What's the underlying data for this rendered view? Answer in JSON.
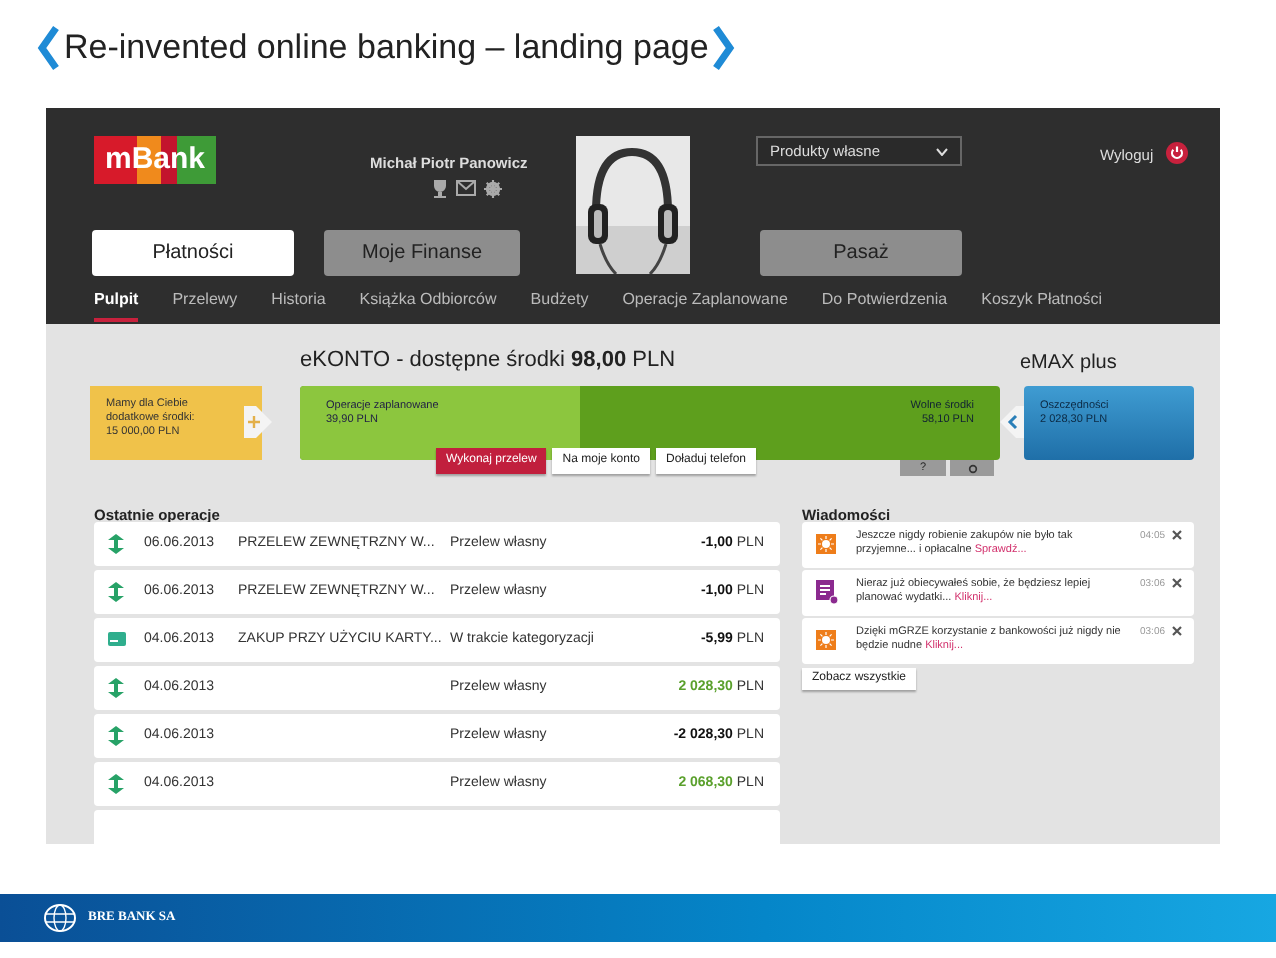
{
  "slide_title": "Re-invented online banking – landing page",
  "header": {
    "logo": "mBank",
    "user_name": "Michał Piotr Panowicz",
    "product_select": "Produkty własne",
    "logout": "Wyloguj"
  },
  "main_tabs": [
    {
      "label": "Płatności",
      "selected": true
    },
    {
      "label": "Moje Finanse",
      "selected": false
    },
    {
      "label": "Pasaż",
      "selected": false
    }
  ],
  "nav": [
    {
      "label": "Pulpit",
      "selected": true
    },
    {
      "label": "Przelewy",
      "selected": false
    },
    {
      "label": "Historia",
      "selected": false
    },
    {
      "label": "Książka Odbiorców",
      "selected": false
    },
    {
      "label": "Budżety",
      "selected": false
    },
    {
      "label": "Operacje Zaplanowane",
      "selected": false
    },
    {
      "label": "Do Potwierdzenia",
      "selected": false
    },
    {
      "label": "Koszyk Płatności",
      "selected": false
    }
  ],
  "account": {
    "title": "eKONTO - dostępne środki **98,00** PLN",
    "offer": [
      "Mamy dla Ciebie",
      "dodatkowe środki:",
      "15 000,00 PLN"
    ],
    "scheduled_label": "Operacje zaplanowane",
    "scheduled_amount": "39,90 PLN",
    "level": 0.4,
    "free_label": "Wolne środki",
    "free_amount": "58,10 PLN",
    "actions": [
      "Wykonaj przelew",
      "Na moje konto",
      "Doładuj telefon"
    ],
    "help": "?"
  },
  "savings": {
    "title": "eMAX plus",
    "label": "Oszczędności",
    "amount": "2 028,30 PLN"
  },
  "operations": {
    "title": "Ostatnie operacje",
    "rows": [
      {
        "kind": "transfer",
        "date": "06.06.2013",
        "description": "PRZELEW ZEWNĘTRZNY W...",
        "category": "Przelew własny",
        "amount": "**-1,00** PLN",
        "credit": false
      },
      {
        "kind": "transfer",
        "date": "06.06.2013",
        "description": "PRZELEW ZEWNĘTRZNY W...",
        "category": "Przelew własny",
        "amount": "**-1,00** PLN",
        "credit": false
      },
      {
        "kind": "card",
        "date": "04.06.2013",
        "description": "ZAKUP PRZY UŻYCIU KARTY...",
        "category": "W trakcie kategoryzacji",
        "amount": "**-5,99** PLN",
        "credit": false
      },
      {
        "kind": "transfer",
        "date": "04.06.2013",
        "category": "Przelew własny",
        "amount": "**2 028,30** PLN",
        "credit": true
      },
      {
        "kind": "transfer",
        "date": "04.06.2013",
        "category": "Przelew własny",
        "amount": "**-2 028,30** PLN",
        "credit": false
      },
      {
        "kind": "transfer",
        "date": "04.06.2013",
        "category": "Przelew własny",
        "amount": "**2 068,30** PLN",
        "credit": true
      }
    ]
  },
  "messages": {
    "title": "Wiadomości",
    "items": [
      {
        "kind": "promo",
        "text": "Jeszcze nigdy robienie zakupów nie było tak przyjemne... i opłacalne",
        "link": "Sprawdź...",
        "time": "04:05"
      },
      {
        "kind": "budget",
        "text": "Nieraz już obiecywałeś sobie, że będziesz lepiej planować wydatki...",
        "link": "Kliknij...",
        "time": "03:06"
      },
      {
        "kind": "promo",
        "text": "Dzięki mGRZE korzystanie z bankowości już nigdy nie będzie nudne",
        "link": "Kliknij...",
        "time": "03:06"
      }
    ],
    "show_all": "Zobacz wszystkie"
  },
  "footer": {
    "company": "BRE BANK SA"
  }
}
